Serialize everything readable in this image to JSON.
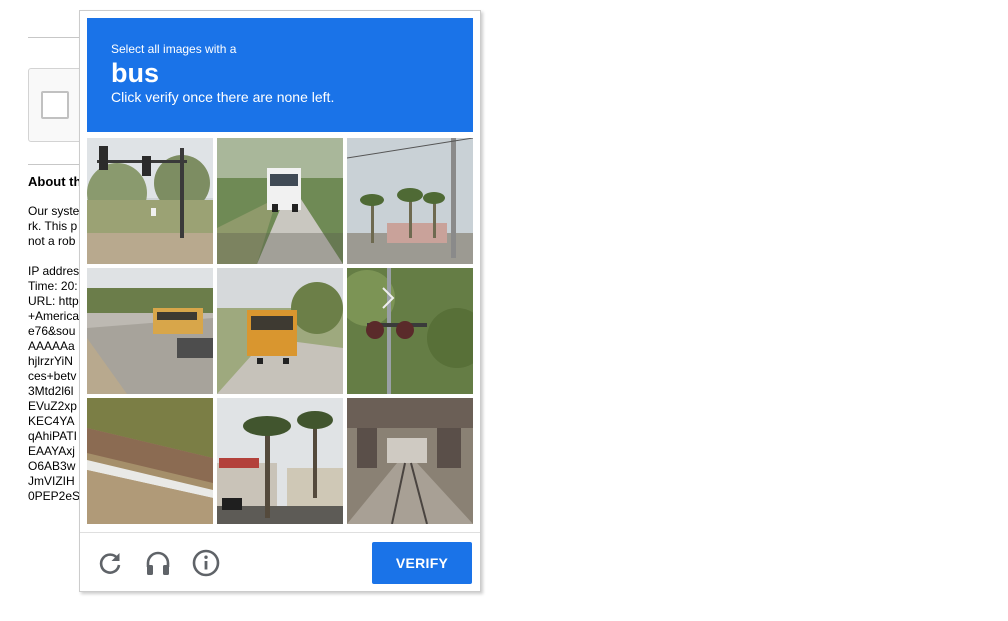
{
  "background": {
    "heading": "About th",
    "paragraph_lines": [
      "Our syste",
      "rk. This p",
      "not a rob"
    ],
    "info_lines": [
      "IP addres",
      "Time: 20:",
      "URL: http",
      "+America",
      "e76&sou",
      "AAAAAa",
      "hjlrzrYiN",
      "ces+betv",
      "3Mtd2l6l",
      "EVuZ2xp",
      "KEC4YA",
      "qAhiPATI",
      "EAAYAxj",
      "O6AB3w",
      "JmVIZIH",
      "0PEP2eS"
    ]
  },
  "challenge": {
    "intro": "Select all images with a",
    "target": "bus",
    "instruction": "Click verify once there are none left.",
    "header_color": "#1a73e8",
    "tiles": [
      {
        "scene": "traffic-light",
        "label": "tile-1"
      },
      {
        "scene": "bus-road-front",
        "label": "tile-2"
      },
      {
        "scene": "palm-street-poles",
        "label": "tile-3"
      },
      {
        "scene": "school-bus-side",
        "label": "tile-4"
      },
      {
        "scene": "school-bus-rear",
        "label": "tile-5"
      },
      {
        "scene": "railroad-crossing-signal",
        "label": "tile-6"
      },
      {
        "scene": "hedge-guardrail",
        "label": "tile-7"
      },
      {
        "scene": "palm-storefront",
        "label": "tile-8"
      },
      {
        "scene": "underpass-tracks",
        "label": "tile-9"
      }
    ],
    "footer": {
      "reload_icon": "reload-icon",
      "audio_icon": "headphones-icon",
      "info_icon": "info-icon",
      "verify_label": "VERIFY"
    }
  }
}
